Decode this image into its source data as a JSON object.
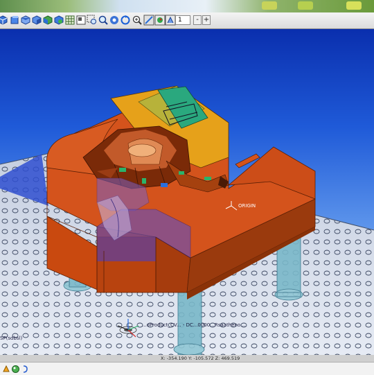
{
  "toolbar": {
    "layer_value": "1",
    "minus_label": "-",
    "plus_label": "+",
    "icons": [
      "view-iso-icon",
      "view-front-icon",
      "view-top-icon",
      "view-side-icon",
      "view-back-icon",
      "view-shaded-icon",
      "grid-icon",
      "layers-icon",
      "zoom-window-icon",
      "zoom-fit-icon",
      "pan-icon",
      "rotate-icon",
      "zoom-icon",
      "shaded-mode-icon",
      "render-icon",
      "dimension-icon"
    ]
  },
  "viewport": {
    "origin_label": "ORIGIN",
    "model_label": "...oProduct_CV... - DC...0000...Rsaatheno....",
    "left_label": "SP(sdbsl)"
  },
  "statusbar": {
    "coordinates": "X: -354.190   Y: -105.572   Z: 469.519"
  },
  "colors": {
    "part_face": "#d4531c",
    "part_side": "#b8430f",
    "part_dark": "#8a3208",
    "yellow_insert": "#e6a11a",
    "green_insert": "#2aa87e",
    "purple_region": "#6a4fb7",
    "background_top": "#0a2fae",
    "plate": "#b7c3d8",
    "pillar": "#7ab8c9"
  }
}
